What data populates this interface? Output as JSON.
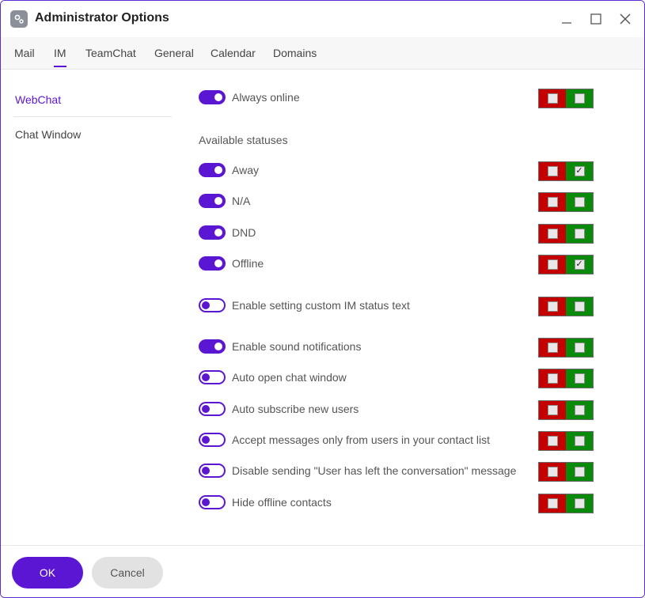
{
  "window": {
    "title": "Administrator Options",
    "icon": "gear-app-icon",
    "controls": [
      "minimize-icon",
      "maximize-icon",
      "close-icon"
    ]
  },
  "tabs": [
    {
      "label": "Mail",
      "active": false
    },
    {
      "label": "IM",
      "active": true
    },
    {
      "label": "TeamChat",
      "active": false
    },
    {
      "label": "General",
      "active": false
    },
    {
      "label": "Calendar",
      "active": false
    },
    {
      "label": "Domains",
      "active": false
    }
  ],
  "sidebar": {
    "items": [
      {
        "label": "WebChat",
        "active": true
      },
      {
        "label": "Chat Window",
        "active": false
      }
    ]
  },
  "content": {
    "available_statuses_label": "Available statuses",
    "options": [
      {
        "label": "Always online",
        "enabled": true,
        "lock_red_checked": false,
        "lock_green_checked": false
      },
      {
        "label": "Away",
        "enabled": true,
        "lock_red_checked": false,
        "lock_green_checked": true
      },
      {
        "label": "N/A",
        "enabled": true,
        "lock_red_checked": false,
        "lock_green_checked": false
      },
      {
        "label": "DND",
        "enabled": true,
        "lock_red_checked": false,
        "lock_green_checked": false
      },
      {
        "label": "Offline",
        "enabled": true,
        "lock_red_checked": false,
        "lock_green_checked": true
      },
      {
        "label": "Enable setting custom IM status text",
        "enabled": false,
        "lock_red_checked": false,
        "lock_green_checked": false
      },
      {
        "label": "Enable sound notifications",
        "enabled": true,
        "lock_red_checked": false,
        "lock_green_checked": false
      },
      {
        "label": "Auto open chat window",
        "enabled": false,
        "lock_red_checked": false,
        "lock_green_checked": false
      },
      {
        "label": "Auto subscribe new users",
        "enabled": false,
        "lock_red_checked": false,
        "lock_green_checked": false
      },
      {
        "label": "Accept messages only from users in your contact list",
        "enabled": false,
        "lock_red_checked": false,
        "lock_green_checked": false
      },
      {
        "label": "Disable sending \"User has left the conversation\" message",
        "enabled": false,
        "lock_red_checked": false,
        "lock_green_checked": false
      },
      {
        "label": "Hide offline contacts",
        "enabled": false,
        "lock_red_checked": false,
        "lock_green_checked": false
      }
    ]
  },
  "footer": {
    "ok_label": "OK",
    "cancel_label": "Cancel"
  },
  "colors": {
    "accent": "#5b16d3",
    "lock_red": "#c40000",
    "lock_green": "#0a8a0a"
  }
}
